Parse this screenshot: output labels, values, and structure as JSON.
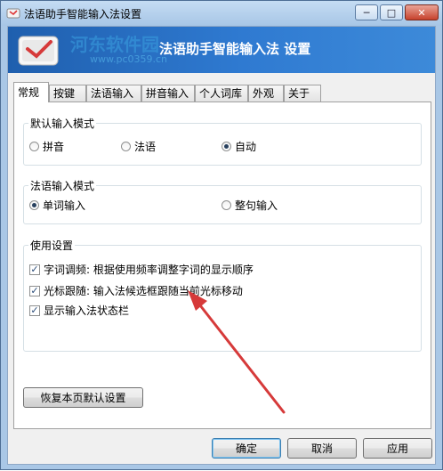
{
  "window": {
    "title": "法语助手智能输入法设置"
  },
  "titlebar_buttons": {
    "minimize": "─",
    "maximize": "□",
    "close": "✕"
  },
  "banner": {
    "title": "法语助手智能输入法 设置",
    "watermark": "河东软件园",
    "watermark_url": "www.pc0359.cn"
  },
  "tabs": [
    "常规",
    "按键",
    "法语输入",
    "拼音输入",
    "个人词库",
    "外观",
    "关于"
  ],
  "active_tab": "常规",
  "groups": {
    "default_mode": {
      "title": "默认输入模式",
      "options": [
        "拼音",
        "法语",
        "自动"
      ],
      "selected": "自动"
    },
    "french_mode": {
      "title": "法语输入模式",
      "options": [
        "单词输入",
        "整句输入"
      ],
      "selected": "单词输入"
    },
    "usage": {
      "title": "使用设置",
      "checks": [
        {
          "label": "字词调频: 根据使用频率调整字词的显示顺序",
          "checked": true
        },
        {
          "label": "光标跟随: 输入法候选框跟随当前光标移动",
          "checked": true
        },
        {
          "label": "显示输入法状态栏",
          "checked": true
        }
      ]
    }
  },
  "restore_button": "恢复本页默认设置",
  "footer": {
    "ok": "确定",
    "cancel": "取消",
    "apply": "应用"
  },
  "colors": {
    "banner": "#2f7ad1",
    "arrow": "#d63a3a",
    "titlebar": "#b7d2ee"
  }
}
